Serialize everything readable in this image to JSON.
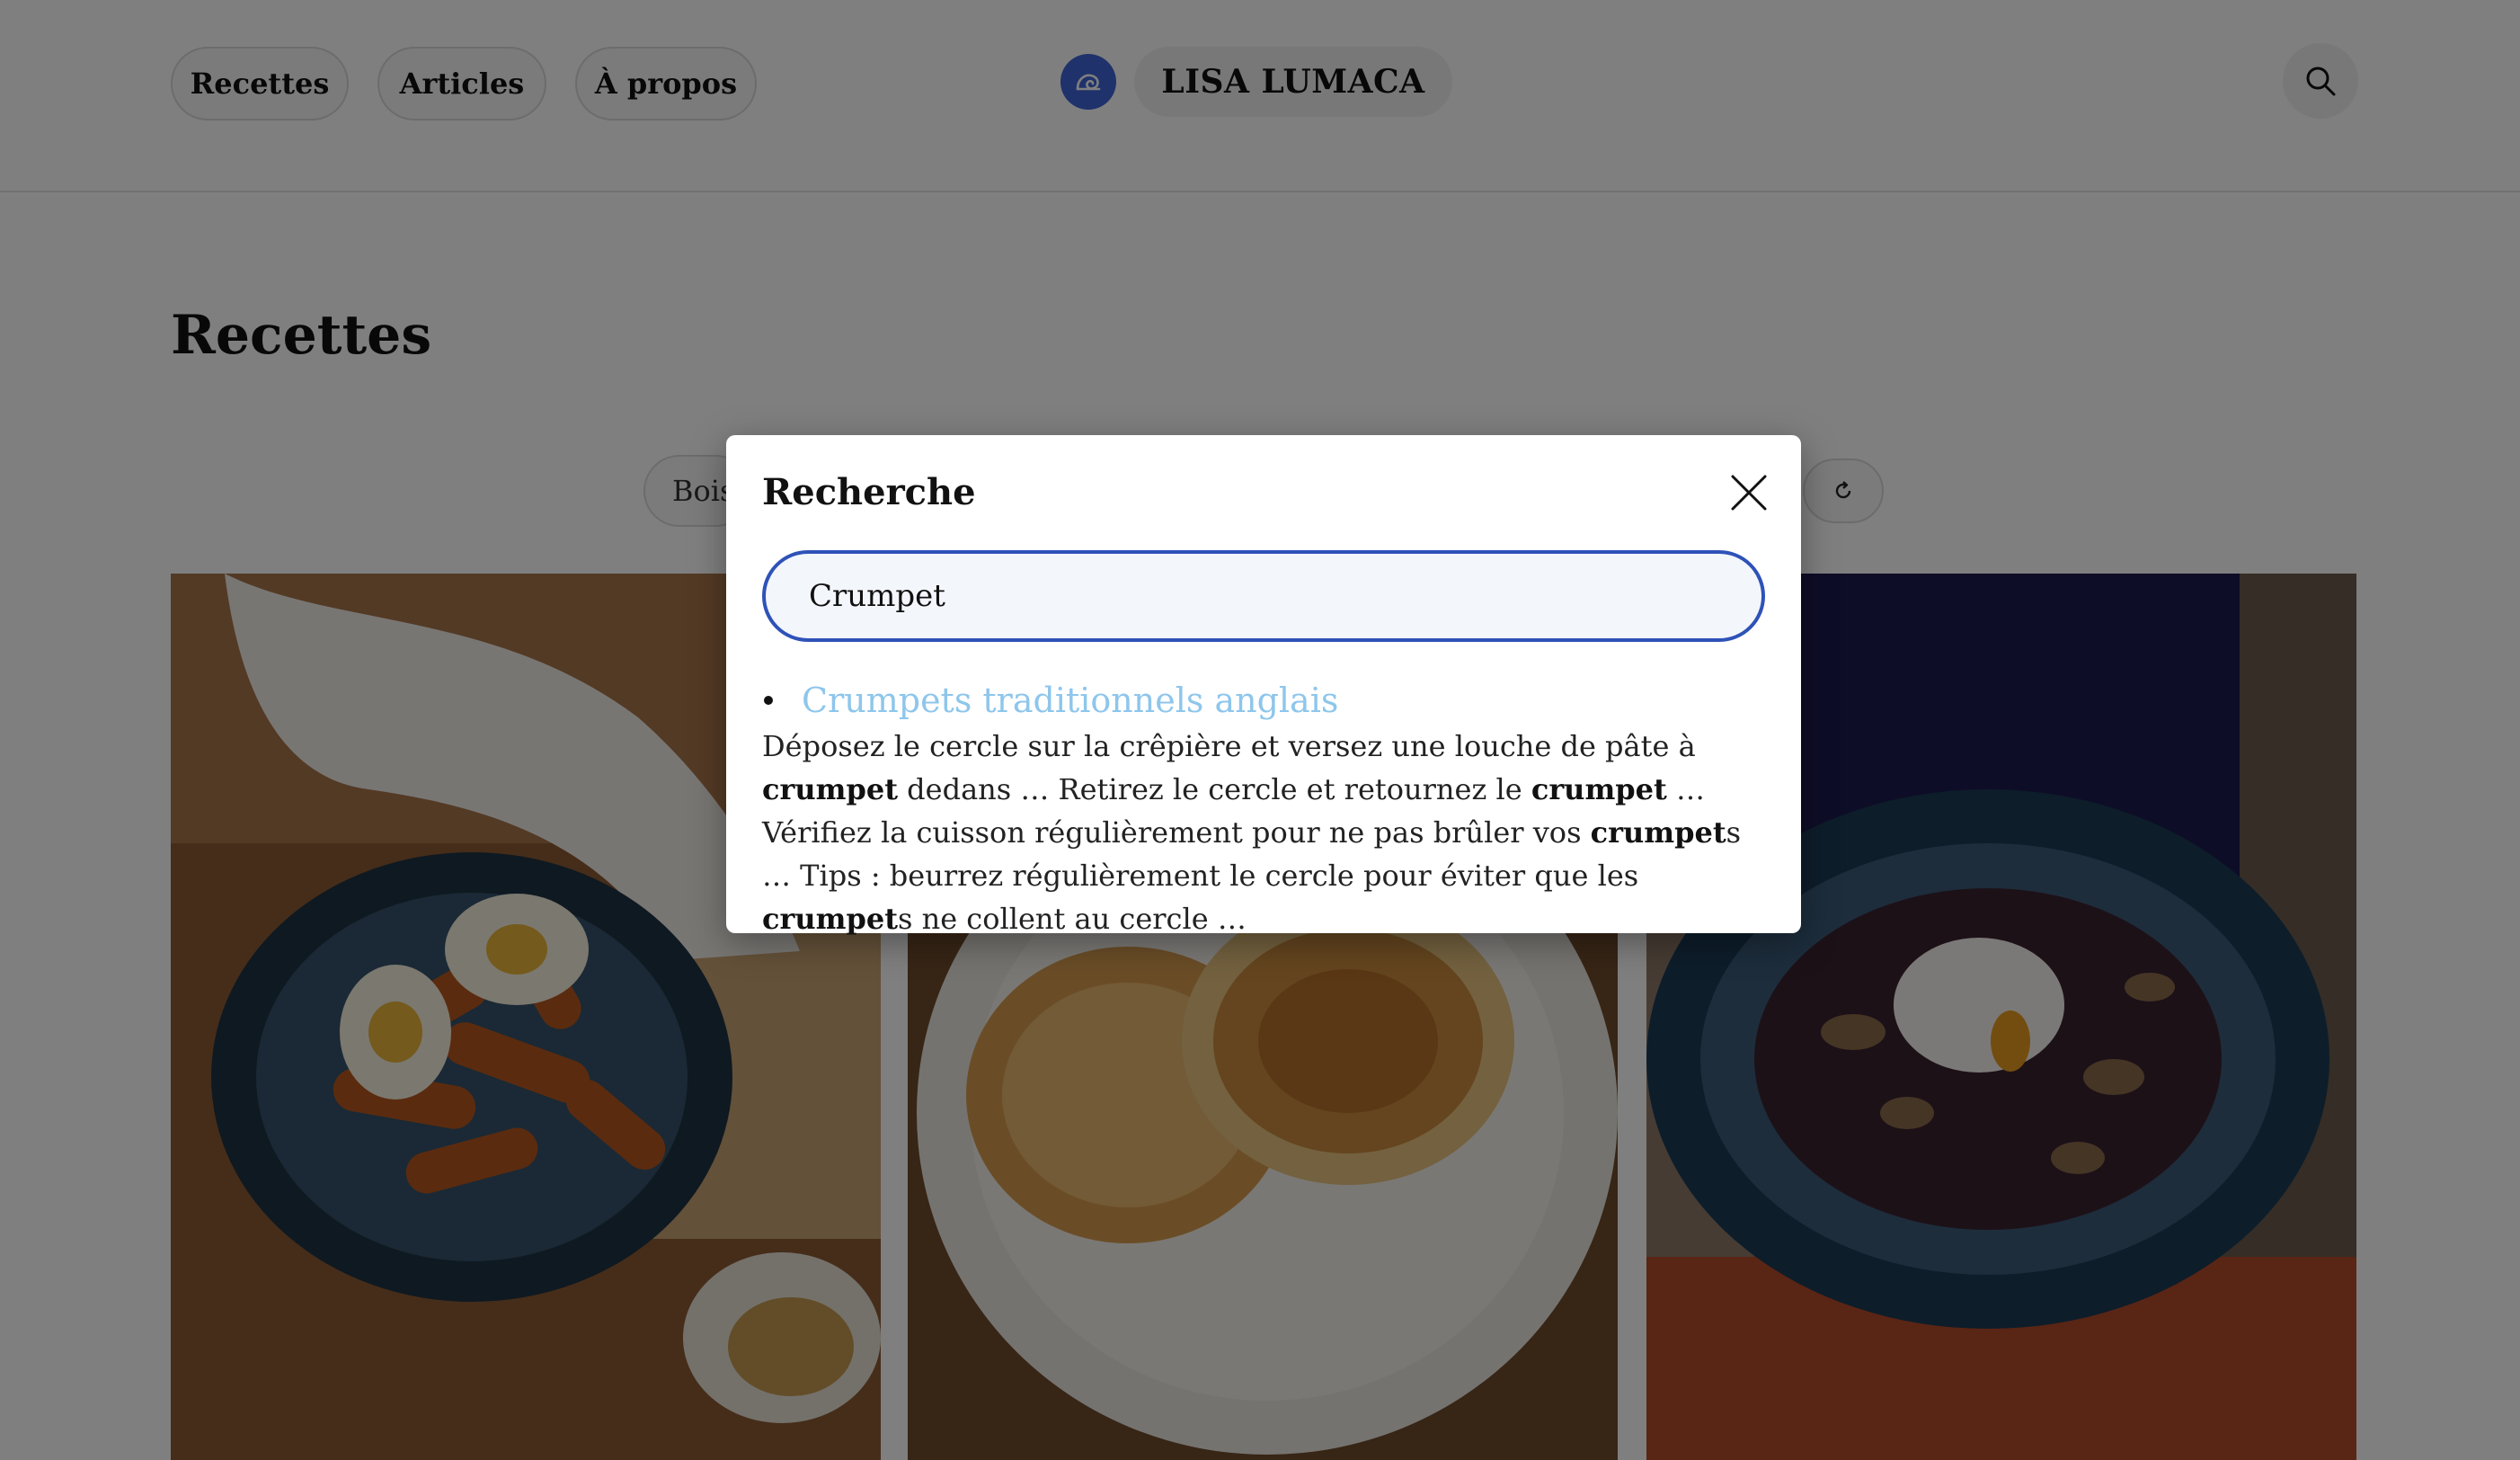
{
  "nav": {
    "items": [
      {
        "label": "Recettes"
      },
      {
        "label": "Articles"
      },
      {
        "label": "À propos"
      }
    ],
    "brand": "LISA LUMACA",
    "logo_icon": "snail-spiral-icon",
    "search_icon": "search-icon"
  },
  "page": {
    "title": "Recettes",
    "filter_label": "Boissons",
    "reset_icon": "refresh-icon"
  },
  "cards": [
    {
      "name": "tteokbokki-bowl"
    },
    {
      "name": "crumpets-plate"
    },
    {
      "name": "mushroom-stew-poached-egg"
    }
  ],
  "modal": {
    "title": "Recherche",
    "close_icon": "close-icon",
    "search_value": "Crumpet",
    "results": [
      {
        "title": "Crumpets traditionnels anglais",
        "excerpt_parts": [
          {
            "t": "Déposez le cercle sur la crêpière et versez une louche de pâte à "
          },
          {
            "t": "crumpet",
            "b": true
          },
          {
            "t": " dedans … Retirez le cercle et retournez le "
          },
          {
            "t": "crumpet",
            "b": true
          },
          {
            "t": " … Vérifiez la cuisson régulièrement pour ne pas brûler vos "
          },
          {
            "t": "crumpet",
            "b": true
          },
          {
            "t": "s … Tips : beurrez régulièrement le cercle pour éviter que les "
          },
          {
            "t": "crumpet",
            "b": true
          },
          {
            "t": "s ne collent au cercle …"
          }
        ]
      }
    ]
  },
  "colors": {
    "accent": "#2e52b8",
    "logo": "#3f64d6",
    "link": "#8ec6ec"
  }
}
